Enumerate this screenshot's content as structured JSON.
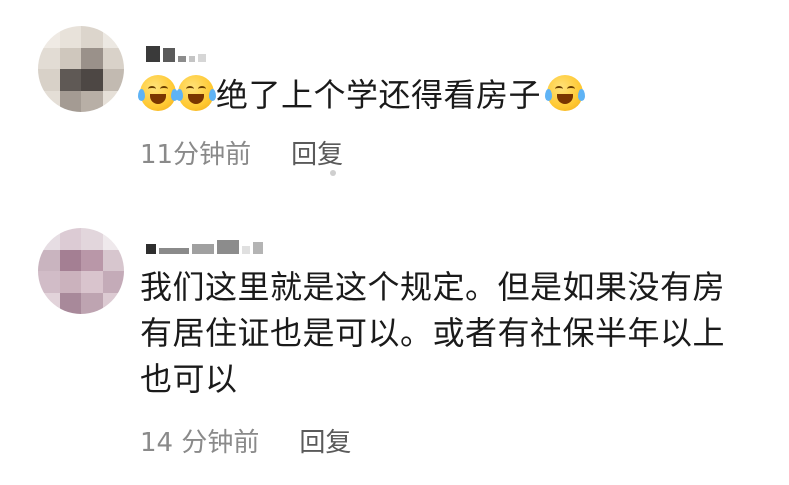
{
  "comments": [
    {
      "username": "蚰,",
      "text": "绝了上个学还得看房子",
      "lines": [
        "绝了上个学还得看房子"
      ],
      "leading_emoji": [
        "laugh-cry-emoji",
        "laugh-cry-emoji"
      ],
      "trailing_emoji": "laugh-cry-emoji",
      "time": "11分钟前",
      "reply_label": "回复"
    },
    {
      "username": "",
      "text": "我们这里就是这个规定。但是如果没有房有居住证也是可以。或者有社保半年以上也可以",
      "lines": [
        "我们这里就是这个规定。但是如果没有房",
        "有居住证也是可以。或者有社保半年以上",
        "也可以"
      ],
      "time": "14 分钟前",
      "reply_label": "回复"
    }
  ],
  "colors": {
    "text": "#1a1a1a",
    "meta": "#8a8a8a",
    "reply": "#5a5a5a",
    "background": "#ffffff"
  }
}
